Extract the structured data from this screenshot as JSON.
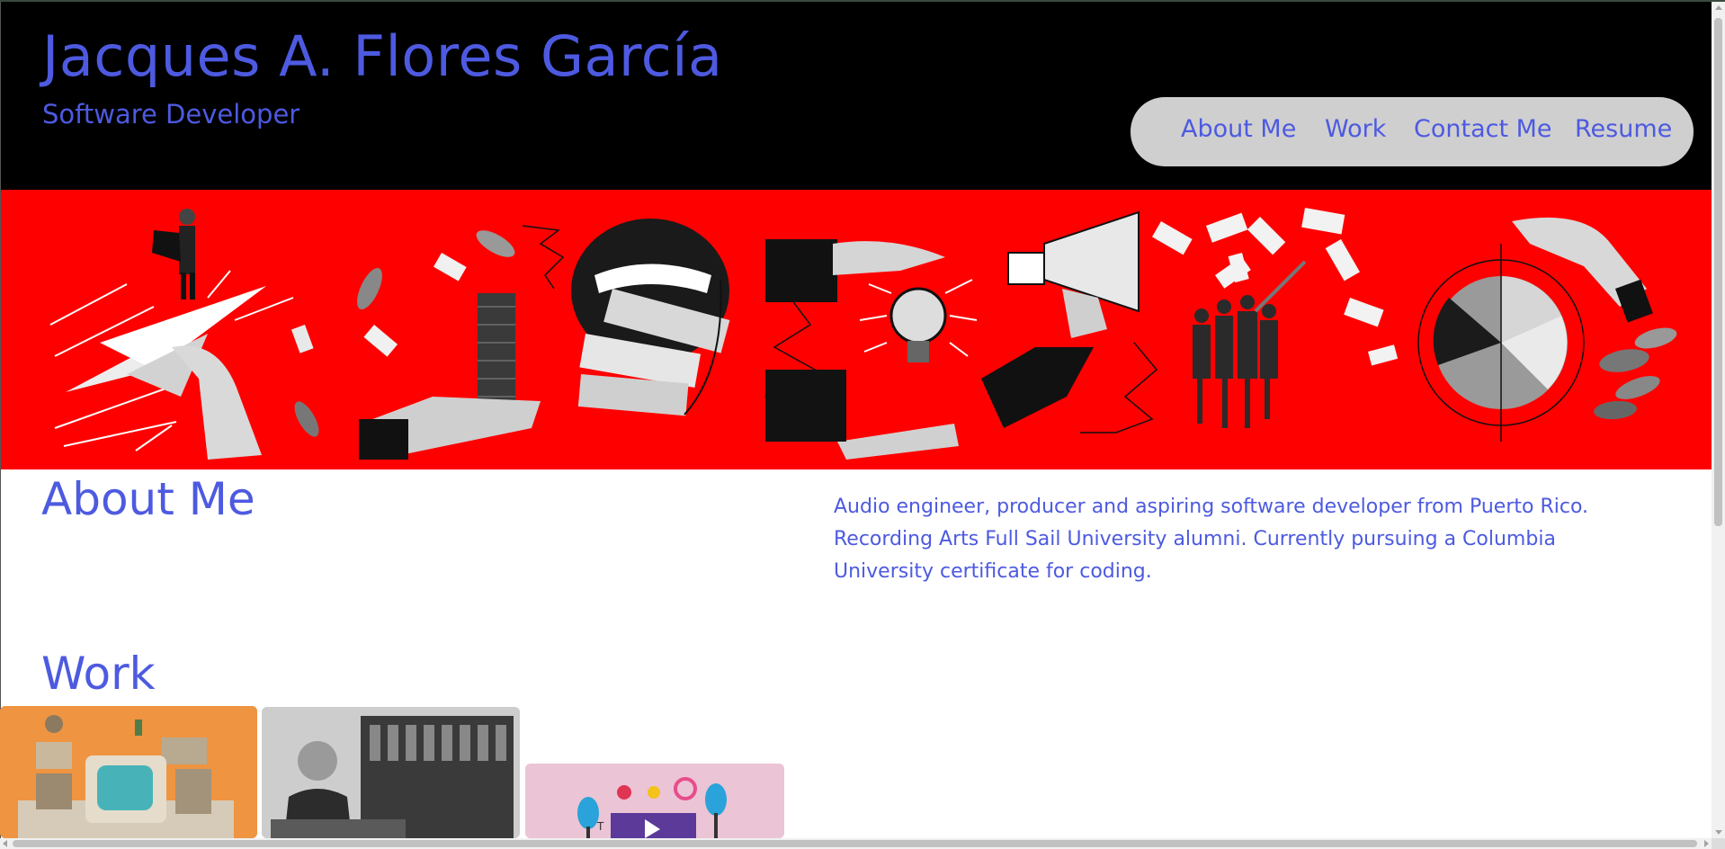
{
  "header": {
    "title": "Jacques A. Flores García",
    "subtitle": "Software Developer"
  },
  "nav": {
    "items": [
      {
        "label": "About Me"
      },
      {
        "label": "Work"
      },
      {
        "label": "Contact Me"
      },
      {
        "label": "Resume"
      }
    ]
  },
  "hero": {
    "image_icon": "collage-banner-image"
  },
  "about": {
    "heading": "About Me",
    "text": "Audio engineer, producer and aspiring software developer from Puerto Rico. Recording Arts Full Sail University alumni. Currently pursuing a Columbia University certificate for coding."
  },
  "work": {
    "heading": "Work",
    "cards": [
      {
        "icon": "retro-electronics-image"
      },
      {
        "icon": "synthesizer-portrait-image"
      },
      {
        "icon": "design-tools-image"
      }
    ]
  },
  "colors": {
    "accent": "#4d5ae0",
    "header_bg": "#000000",
    "hero_bg": "#ff0000",
    "nav_bg": "#cfcfcf"
  }
}
